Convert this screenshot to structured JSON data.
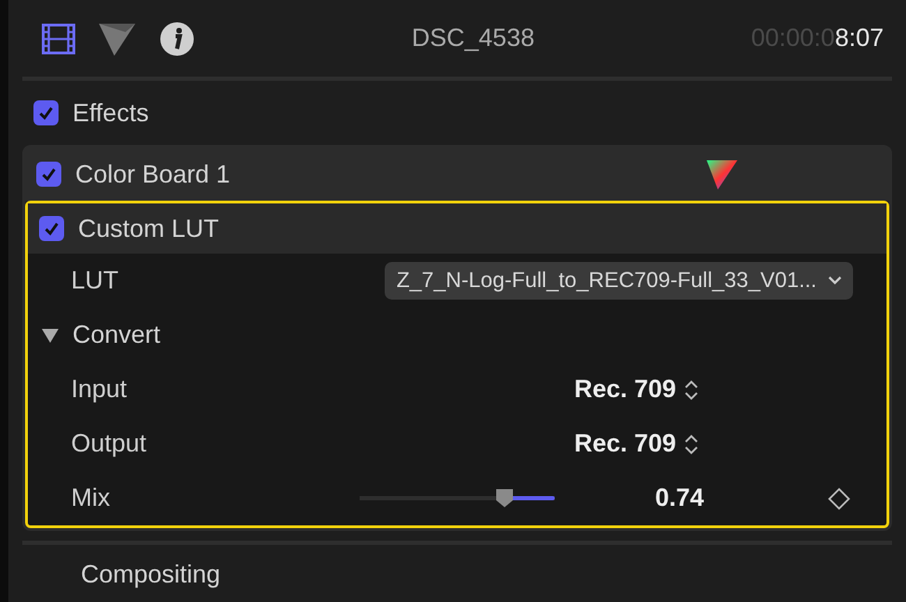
{
  "header": {
    "title": "DSC_4538",
    "timecode_dim": "00:00:0",
    "timecode": "8:07"
  },
  "effects": {
    "label": "Effects",
    "checked": true
  },
  "color_board": {
    "label": "Color Board 1",
    "checked": true
  },
  "custom_lut": {
    "label": "Custom LUT",
    "checked": true,
    "selected": true,
    "lut": {
      "label": "LUT",
      "value": "Z_7_N-Log-Full_to_REC709-Full_33_V01..."
    },
    "convert": {
      "label": "Convert",
      "expanded": true,
      "params": [
        {
          "kind": "popup",
          "label": "Input",
          "value": "Rec. 709"
        },
        {
          "kind": "popup",
          "label": "Output",
          "value": "Rec. 709"
        },
        {
          "kind": "slider",
          "label": "Mix",
          "level": 0.74,
          "value": "0.74"
        }
      ]
    }
  },
  "compositing": {
    "label": "Compositing"
  }
}
